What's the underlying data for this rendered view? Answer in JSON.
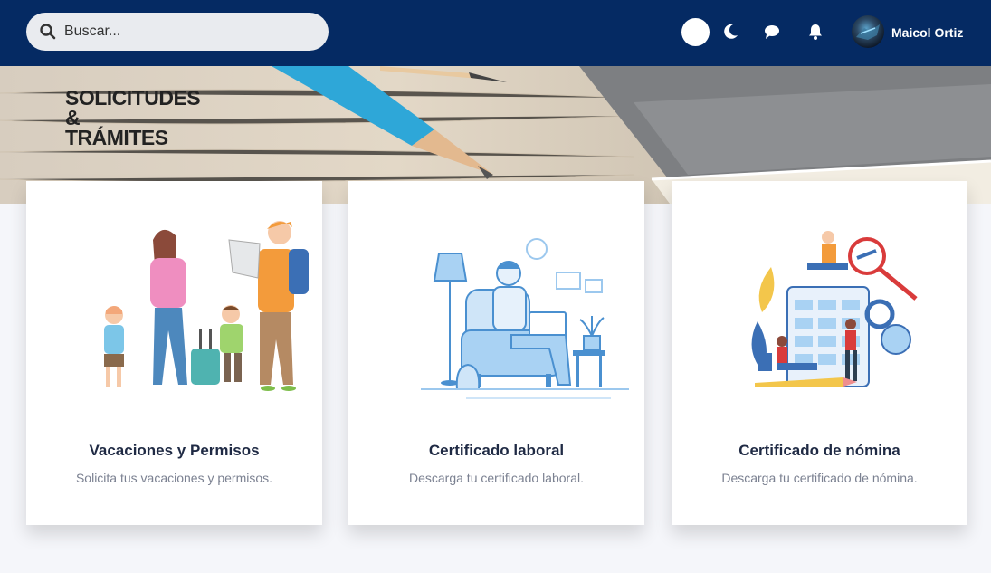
{
  "header": {
    "search": {
      "placeholder": "Buscar..."
    },
    "user": {
      "name": "Maicol Ortiz"
    },
    "icons": [
      "theme-toggle",
      "moon-icon",
      "chat-icon",
      "bell-icon",
      "avatar"
    ],
    "colors": {
      "topbar": "#052a63",
      "search_bg": "#e9ebef"
    }
  },
  "hero": {
    "title_line1": "SOLICITUDES",
    "title_line2": "&",
    "title_line3": "TRÁMITES"
  },
  "cards": [
    {
      "title": "Vacaciones y Permisos",
      "description": "Solicita tus vacaciones y permisos."
    },
    {
      "title": "Certificado laboral",
      "description": "Descarga tu certificado laboral."
    },
    {
      "title": "Certificado de nómina",
      "description": "Descarga tu certificado de nómina."
    }
  ]
}
